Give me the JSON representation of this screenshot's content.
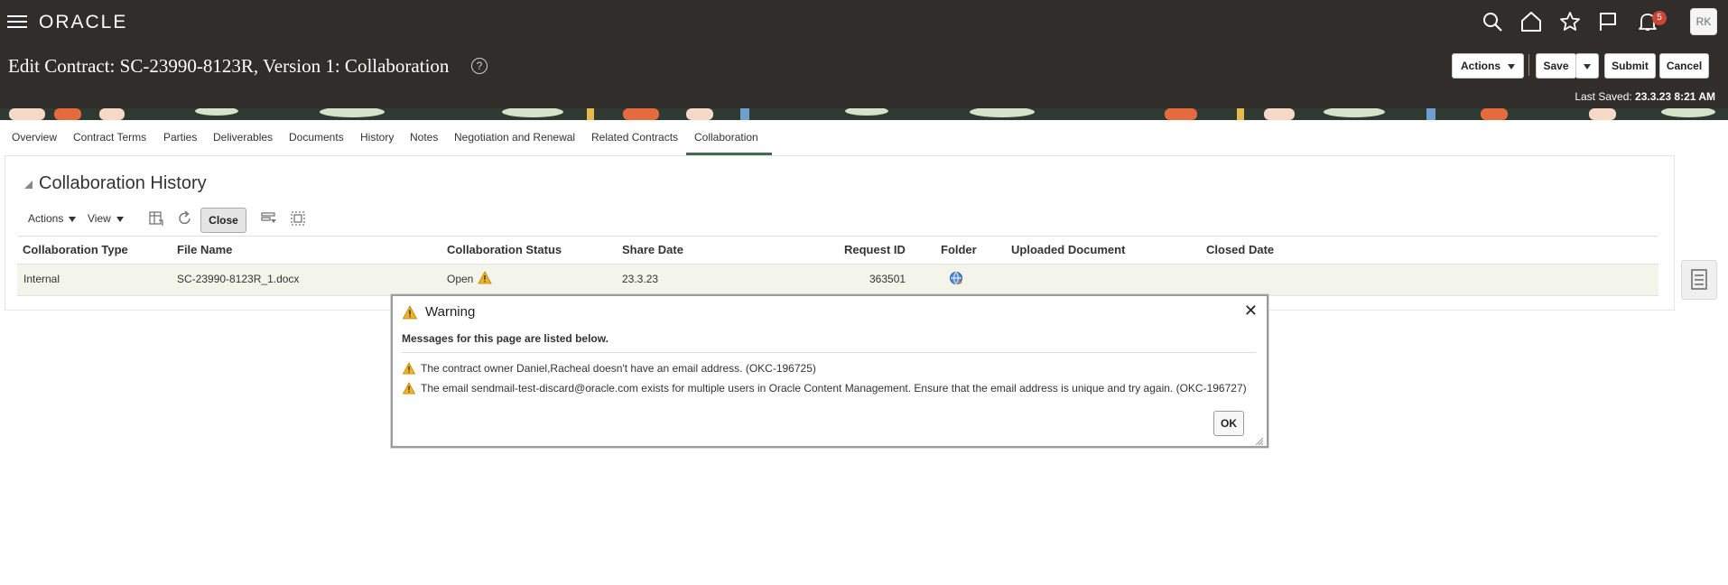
{
  "header": {
    "logo": "ORACLE",
    "notification_count": "5",
    "avatar_initials": "RK",
    "page_title": "Edit Contract: SC-23990-8123R, Version 1: Collaboration",
    "help_glyph": "?",
    "buttons": {
      "actions": "Actions",
      "save": "Save",
      "submit": "Submit",
      "cancel": "Cancel"
    },
    "last_saved_label": "Last Saved:",
    "last_saved_value": "23.3.23 8:21 AM",
    "icons": [
      "hamburger-icon",
      "search-icon",
      "home-icon",
      "star-icon",
      "flag-icon",
      "bell-icon"
    ]
  },
  "tabs": [
    "Overview",
    "Contract Terms",
    "Parties",
    "Deliverables",
    "Documents",
    "History",
    "Notes",
    "Negotiation and Renewal",
    "Related Contracts",
    "Collaboration"
  ],
  "active_tab": "Collaboration",
  "section": {
    "title": "Collaboration History",
    "toolbar": {
      "actions": "Actions",
      "view": "View",
      "close": "Close"
    },
    "columns": [
      "Collaboration Type",
      "File Name",
      "Collaboration Status",
      "Share Date",
      "Request ID",
      "Folder",
      "Uploaded Document",
      "Closed Date"
    ],
    "rows": [
      {
        "type": "Internal",
        "file": "SC-23990-8123R_1.docx",
        "status": "Open",
        "share_date": "23.3.23",
        "request_id": "363501",
        "uploaded": "",
        "closed": ""
      }
    ]
  },
  "dialog": {
    "title": "Warning",
    "subtitle": "Messages for this page are listed below.",
    "messages": [
      "The contract owner Daniel,Racheal doesn't have an email address. (OKC-196725)",
      "The email sendmail-test-discard@oracle.com exists for multiple users in Oracle Content Management. Ensure that the email address is unique and try again. (OKC-196727)"
    ],
    "ok": "OK",
    "close_glyph": "✕"
  },
  "colors": {
    "header_bg": "#312d2a",
    "badge": "#c74634",
    "row_bg": "#f3f5ea",
    "tab_underline": "#3f6b4f",
    "warning": "#f0b323"
  }
}
